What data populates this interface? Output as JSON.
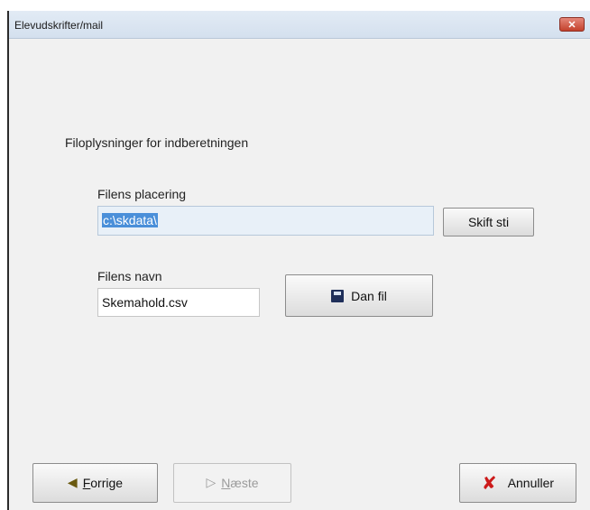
{
  "window": {
    "title": "Elevudskrifter/mail",
    "close_symbol": "✕"
  },
  "section": {
    "title": "Filoplysninger for indberetningen"
  },
  "location": {
    "label": "Filens placering",
    "value": "c:\\skdata\\",
    "change_path_label": "Skift sti"
  },
  "filename": {
    "label": "Filens navn",
    "value": "Skemahold.csv",
    "create_file_label": "Dan fil",
    "create_file_icon": "floppy-disk-icon"
  },
  "footer": {
    "previous": {
      "mnemonic": "F",
      "rest": "orrige",
      "icon": "arrow-left-icon"
    },
    "next": {
      "mnemonic": "N",
      "rest": "æste",
      "icon": "arrow-right-icon",
      "enabled": false
    },
    "cancel": {
      "label": "Annuller",
      "icon": "cancel-x-icon"
    }
  },
  "colors": {
    "selection": "#4a8fd9",
    "close_button": "#c3412c",
    "cancel_icon": "#cc1a1a"
  }
}
